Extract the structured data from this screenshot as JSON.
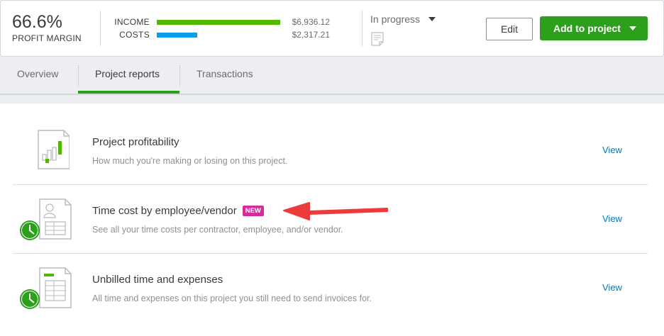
{
  "header": {
    "profit_margin_value": "66.6%",
    "profit_margin_label": "PROFIT MARGIN",
    "income_label": "INCOME",
    "income_amount": "$6,936.12",
    "income_fraction": 1.0,
    "costs_label": "COSTS",
    "costs_amount": "$2,317.21",
    "costs_fraction": 0.33,
    "income_color": "#53b700",
    "costs_color": "#0d9ce8",
    "status_value": "In progress",
    "edit_label": "Edit",
    "add_label": "Add to project",
    "accent_color": "#2ca01c"
  },
  "tabs": [
    {
      "label": "Overview",
      "active": false
    },
    {
      "label": "Project reports",
      "active": true
    },
    {
      "label": "Transactions",
      "active": false
    }
  ],
  "reports": [
    {
      "icon": "profitability-report-icon",
      "title": "Project profitability",
      "badge": "",
      "description": "How much you're making or losing on this project.",
      "action": "View"
    },
    {
      "icon": "time-cost-report-icon",
      "title": "Time cost by employee/vendor",
      "badge": "NEW",
      "description": "See all your time costs per contractor, employee, and/or vendor.",
      "action": "View"
    },
    {
      "icon": "unbilled-time-report-icon",
      "title": "Unbilled time and expenses",
      "badge": "",
      "description": "All time and expenses on this project you still need to send invoices for.",
      "action": "View"
    }
  ],
  "annotation": {
    "arrow_color": "#ec3b3b"
  }
}
